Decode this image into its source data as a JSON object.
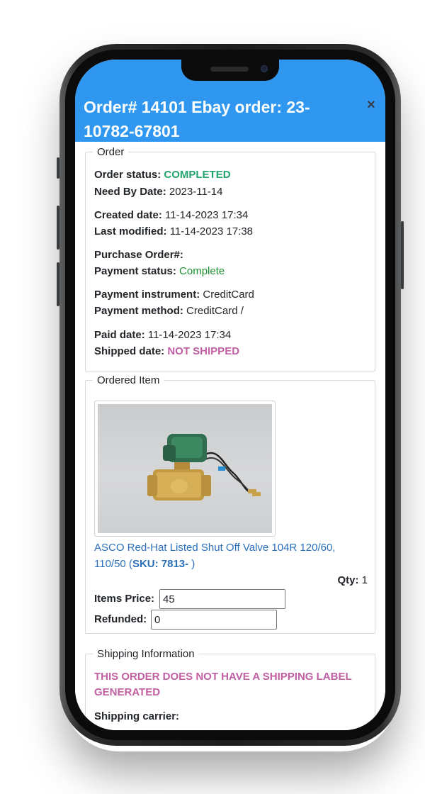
{
  "modal": {
    "title": "Order# 14101 Ebay order: 23-10782-67801",
    "close": "×"
  },
  "order": {
    "legend": "Order",
    "status_label": "Order status:",
    "status_value": "COMPLETED",
    "need_by_label": "Need By Date:",
    "need_by_value": "2023-11-14",
    "created_label": "Created date:",
    "created_value": "11-14-2023 17:34",
    "modified_label": "Last modified:",
    "modified_value": "11-14-2023 17:38",
    "po_label": "Purchase Order#:",
    "po_value": "",
    "payment_status_label": "Payment status:",
    "payment_status_value": "Complete",
    "instrument_label": "Payment instrument:",
    "instrument_value": "CreditCard",
    "method_label": "Payment method:",
    "method_value": "CreditCard /",
    "paid_label": "Paid date:",
    "paid_value": "11-14-2023 17:34",
    "shipped_label": "Shipped date:",
    "shipped_value": "NOT SHIPPED"
  },
  "item": {
    "legend": "Ordered Item",
    "name_line1": "ASCO Red-Hat Listed Shut Off Valve 104R 120/60,",
    "name_line2_prefix": "110/50 (",
    "sku": "SKU: 7813-",
    "name_line2_suffix": " )",
    "qty_label": "Qty:",
    "qty_value": "1",
    "price_label": "Items Price:",
    "price_value": "45",
    "refunded_label": "Refunded:",
    "refunded_value": "0"
  },
  "shipping": {
    "legend": "Shipping Information",
    "warning_line1": "THIS ORDER DOES NOT HAVE A SHIPPING LABEL",
    "warning_line2": "GENERATED",
    "carrier_label": "Shipping carrier:"
  },
  "colors": {
    "header": "#2f97ef",
    "completed": "#23a36c",
    "not_shipped": "#c05fa2",
    "link": "#2a6fb8"
  }
}
